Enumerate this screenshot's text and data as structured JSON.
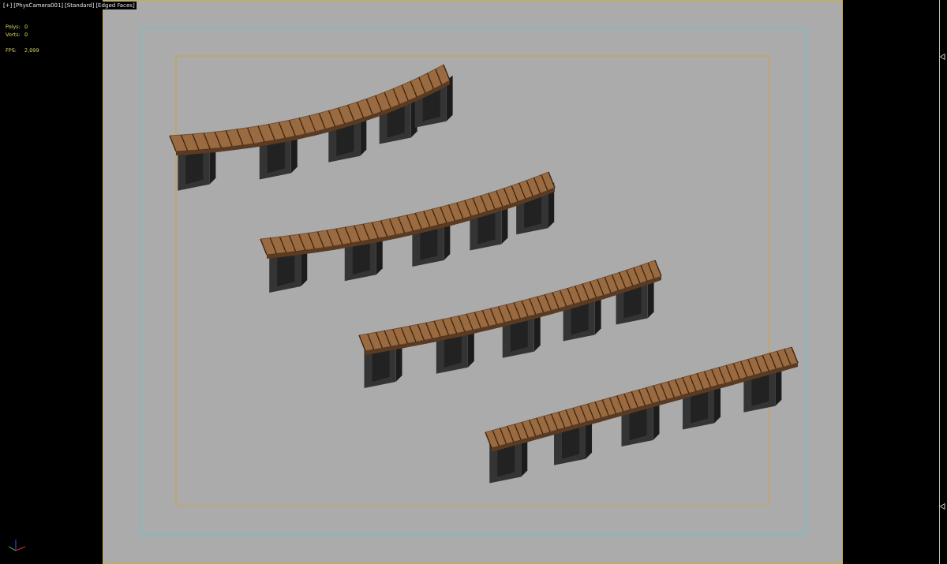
{
  "viewport": {
    "label": [
      "[+]",
      "[PhysCamera001]",
      "[Standard]",
      "[Edged Faces]"
    ],
    "stats": [
      {
        "name": "Polys:",
        "value": "0"
      },
      {
        "name": "Verts:",
        "value": "0"
      },
      {
        "name": "FPS:",
        "value": "2,099"
      }
    ]
  }
}
